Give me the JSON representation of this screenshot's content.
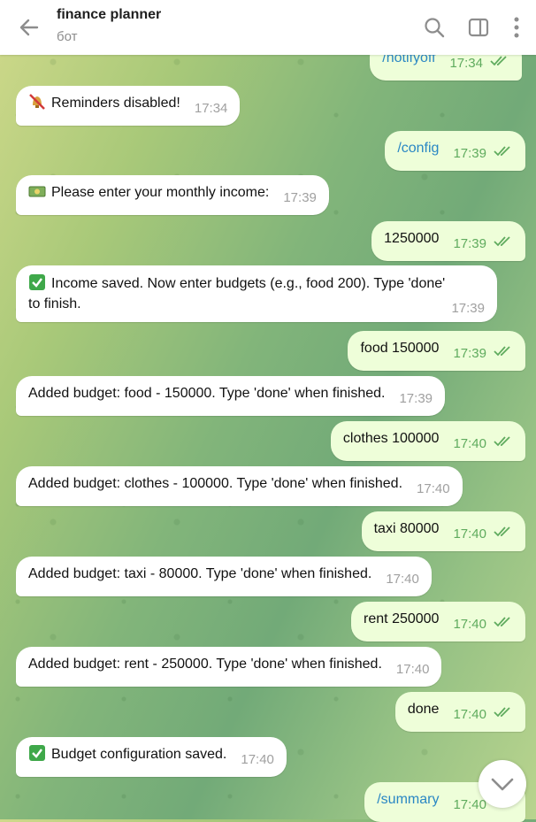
{
  "header": {
    "title": "finance planner",
    "subtitle": "бот"
  },
  "messages": [
    {
      "dir": "out",
      "text": "/notifyoff",
      "time": "17:34",
      "link": true
    },
    {
      "dir": "in",
      "emoji": "muted-bell",
      "text": "Reminders disabled!",
      "time": "17:34"
    },
    {
      "dir": "out",
      "text": "/config",
      "time": "17:39",
      "link": true
    },
    {
      "dir": "in",
      "emoji": "money",
      "text": "Please enter your monthly income:",
      "time": "17:39"
    },
    {
      "dir": "out",
      "text": "1250000",
      "time": "17:39"
    },
    {
      "dir": "in",
      "emoji": "check",
      "text": "Income saved. Now enter budgets (e.g., food 200). Type 'done'",
      "text2": "to finish.",
      "time": "17:39"
    },
    {
      "dir": "out",
      "text": "food 150000",
      "time": "17:39"
    },
    {
      "dir": "in",
      "text": "Added budget: food - 150000. Type 'done' when finished.",
      "time": "17:39"
    },
    {
      "dir": "out",
      "text": "clothes 100000",
      "time": "17:40"
    },
    {
      "dir": "in",
      "text": "Added budget: clothes - 100000. Type 'done' when finished.",
      "time": "17:40"
    },
    {
      "dir": "out",
      "text": "taxi 80000",
      "time": "17:40"
    },
    {
      "dir": "in",
      "text": "Added budget: taxi - 80000. Type 'done' when finished.",
      "time": "17:40"
    },
    {
      "dir": "out",
      "text": "rent 250000",
      "time": "17:40"
    },
    {
      "dir": "in",
      "text": "Added budget: rent - 250000. Type 'done' when finished.",
      "time": "17:40"
    },
    {
      "dir": "out",
      "text": "done",
      "time": "17:40"
    },
    {
      "dir": "in",
      "emoji": "check",
      "text": "Budget configuration saved.",
      "time": "17:40"
    },
    {
      "dir": "out",
      "text": "/summary",
      "time": "17:40",
      "link": true
    }
  ],
  "colors": {
    "incoming_bubble": "#ffffff",
    "outgoing_bubble": "#eefed9",
    "outgoing_time": "#5fab5e",
    "link": "#2a87c4"
  }
}
